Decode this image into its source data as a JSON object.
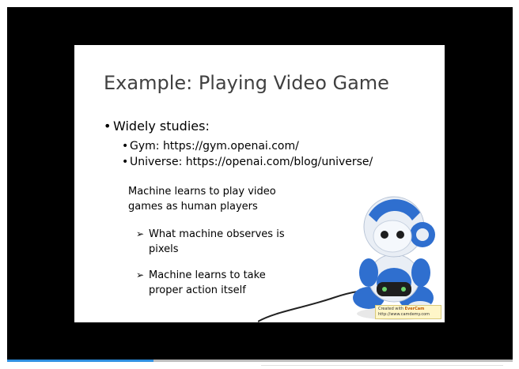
{
  "slide": {
    "title": "Example: Playing Video Game",
    "bullet": "Widely studies:",
    "sub_bullets": [
      "Gym: https://gym.openai.com/",
      "Universe: https://openai.com/blog/universe/"
    ],
    "paragraph": "Machine learns to play video games as human players",
    "arrow_items": [
      "What machine observes is pixels",
      "Machine learns to take proper action itself"
    ]
  },
  "watermark": {
    "line1_prefix": "Created with ",
    "brand": "EverCam",
    "line2": "http://www.camdemy.com"
  },
  "player": {
    "progress": 0.29,
    "progress_color": "#2f8fe0"
  },
  "icons": {
    "robot": "robot-gamer-illustration",
    "arrow": "arrowhead-bullet-icon"
  }
}
